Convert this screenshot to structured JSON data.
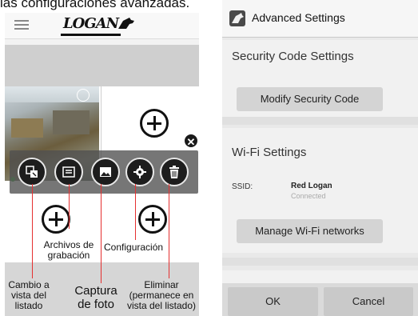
{
  "caption": "las configuraciones avanzadas.",
  "left_app": {
    "logo_text": "LOGAN",
    "toolbar_icons": [
      "list-swap-icon",
      "recordings-icon",
      "photo-icon",
      "settings-icon",
      "trash-icon"
    ],
    "labels": {
      "archivos": "Archivos de\ngrabación",
      "configuracion": "Configuración",
      "cambio": "Cambio a\nvista del\nlistado",
      "captura": "Captura\nde foto",
      "eliminar": "Eliminar\n(permanece en\nvista del listado)"
    },
    "accent_line_color": "#e53030"
  },
  "right_app": {
    "title": "Advanced Settings",
    "security": {
      "heading": "Security Code Settings",
      "button": "Modify Security Code"
    },
    "wifi": {
      "heading": "Wi-Fi Settings",
      "ssid_label": "SSID:",
      "ssid_value": "Red Logan",
      "ssid_status": "Connected",
      "button": "Manage Wi-Fi networks"
    },
    "footer": {
      "ok": "OK",
      "cancel": "Cancel"
    }
  }
}
